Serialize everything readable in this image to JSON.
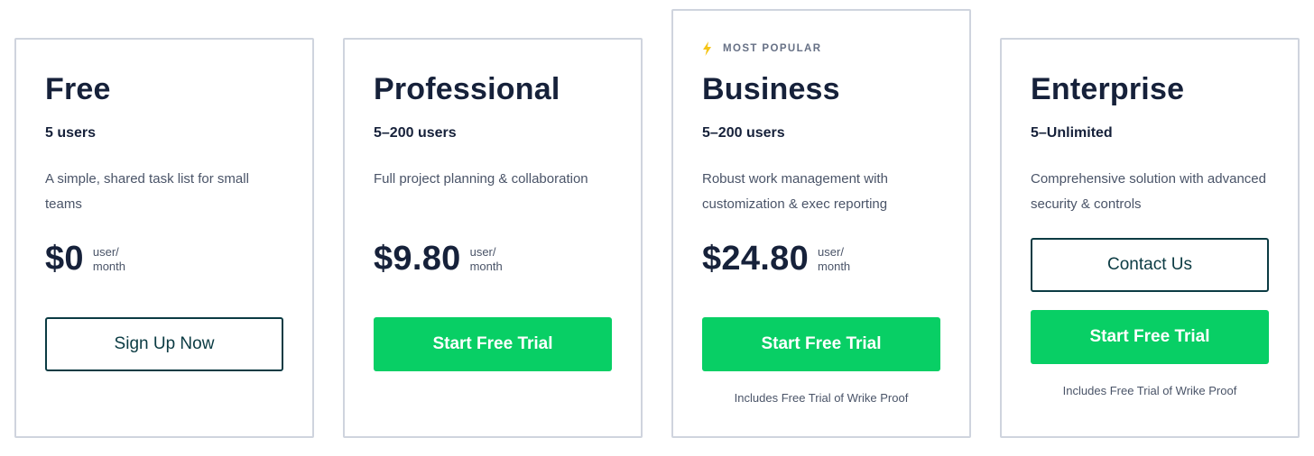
{
  "plans": [
    {
      "name": "Free",
      "users": "5 users",
      "description": "A simple, shared task list for small teams",
      "price": "$0",
      "unit_line1": "user/",
      "unit_line2": "month",
      "button_label": "Sign Up Now"
    },
    {
      "name": "Professional",
      "users": "5–200 users",
      "description": "Full project planning & collaboration",
      "price": "$9.80",
      "unit_line1": "user/",
      "unit_line2": "month",
      "button_label": "Start Free Trial"
    },
    {
      "badge": "MOST POPULAR",
      "badge_icon": "lightning-bolt-icon",
      "name": "Business",
      "users": "5–200 users",
      "description": "Robust work management with customization & exec reporting",
      "price": "$24.80",
      "unit_line1": "user/",
      "unit_line2": "month",
      "button_label": "Start Free Trial",
      "note": "Includes Free Trial of Wrike Proof"
    },
    {
      "name": "Enterprise",
      "users": "5–Unlimited",
      "description": "Comprehensive solution with advanced security & controls",
      "contact_label": "Contact Us",
      "button_label": "Start Free Trial",
      "note": "Includes Free Trial of Wrike Proof"
    }
  ],
  "colors": {
    "accent_green": "#08cf65",
    "outline_button": "#0b3b43",
    "badge_icon": "#f5c518",
    "card_border": "#cfd4de",
    "heading": "#16213a"
  }
}
